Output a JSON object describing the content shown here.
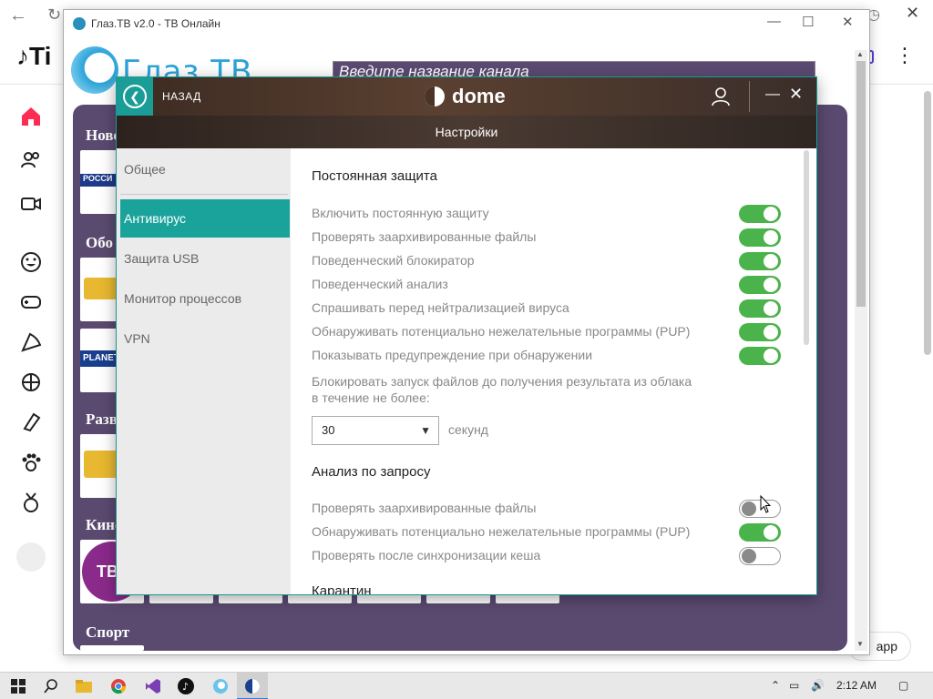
{
  "background_browser": {
    "tiktok_logo": "Ti",
    "app_button": "app",
    "sidebar_icons": [
      "home-icon",
      "following-icon",
      "live-icon",
      "emoji-icon",
      "gaming-icon",
      "food-icon",
      "sports-icon",
      "beauty-icon",
      "pets-icon",
      "achievement-icon"
    ]
  },
  "glaz_window": {
    "title": "Глаз.ТВ v2.0 - ТВ Онлайн",
    "logo_text": "Глаз.ТВ",
    "search_placeholder": "Введите название канала",
    "categories": [
      "Новости",
      "Обо",
      "Разв",
      "Кино",
      "Спорт"
    ],
    "tile_labels": [
      "РОССИ",
      "PLANET",
      "ТВ3"
    ]
  },
  "dome": {
    "back_label": "НАЗАД",
    "brand": "dome",
    "settings_title": "Настройки",
    "sidebar": {
      "items": [
        {
          "label": "Общее",
          "active": false
        },
        {
          "label": "Антивирус",
          "active": true
        },
        {
          "label": "Защита USB",
          "active": false
        },
        {
          "label": "Монитор процессов",
          "active": false
        },
        {
          "label": "VPN",
          "active": false
        }
      ]
    },
    "realtime": {
      "title": "Постоянная защита",
      "options": [
        {
          "label": "Включить постоянную защиту",
          "on": true
        },
        {
          "label": "Проверять заархивированные файлы",
          "on": true
        },
        {
          "label": "Поведенческий блокиратор",
          "on": true
        },
        {
          "label": "Поведенческий анализ",
          "on": true
        },
        {
          "label": "Спрашивать перед нейтрализацией вируса",
          "on": true
        },
        {
          "label": "Обнаруживать потенциально нежелательные программы (PUP)",
          "on": true
        },
        {
          "label": "Показывать предупреждение при обнаружении",
          "on": true
        }
      ],
      "cloud_block_line1": "Блокировать запуск файлов до получения результата из облака",
      "cloud_block_line2": "в течение не более:",
      "cloud_value": "30",
      "cloud_unit": "секунд"
    },
    "ondemand": {
      "title": "Анализ по запросу",
      "options": [
        {
          "label": "Проверять заархивированные файлы",
          "on": false
        },
        {
          "label": "Обнаруживать потенциально нежелательные программы (PUP)",
          "on": true
        },
        {
          "label": "Проверять после синхронизации кеша",
          "on": false
        }
      ]
    },
    "quarantine_title": "Карантин"
  },
  "taskbar": {
    "time": "2:12 AM",
    "apps": [
      "windows-start-icon",
      "search-icon",
      "file-explorer-icon",
      "chrome-icon",
      "visual-studio-icon",
      "tiktok-icon",
      "glaz-tv-icon",
      "dome-icon"
    ]
  },
  "colors": {
    "accent": "#1aa39b",
    "toggle_on": "#4bb34b",
    "glaz_purple": "#5a4a70"
  }
}
